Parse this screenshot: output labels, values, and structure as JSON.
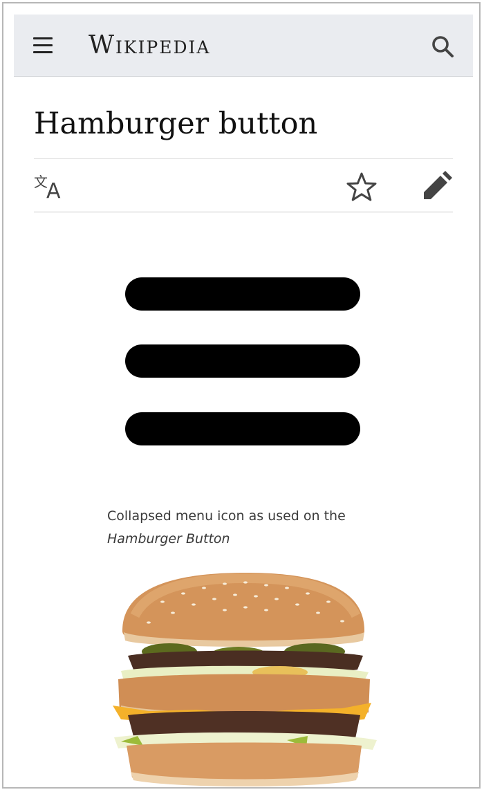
{
  "header": {
    "wordmark": "Wikipedia",
    "menu_icon": "hamburger-menu-icon",
    "search_icon": "search-icon",
    "background": "#eaecf0"
  },
  "article": {
    "title": "Hamburger button",
    "actions": {
      "language_icon": "language-icon",
      "watch_icon": "star-icon",
      "edit_icon": "pencil-icon"
    }
  },
  "figure": {
    "icon": "hamburger-menu-icon",
    "caption_text": "Collapsed menu icon as used on the",
    "caption_italic": "Hamburger Button"
  },
  "photo": {
    "subject": "hamburger-photo"
  }
}
